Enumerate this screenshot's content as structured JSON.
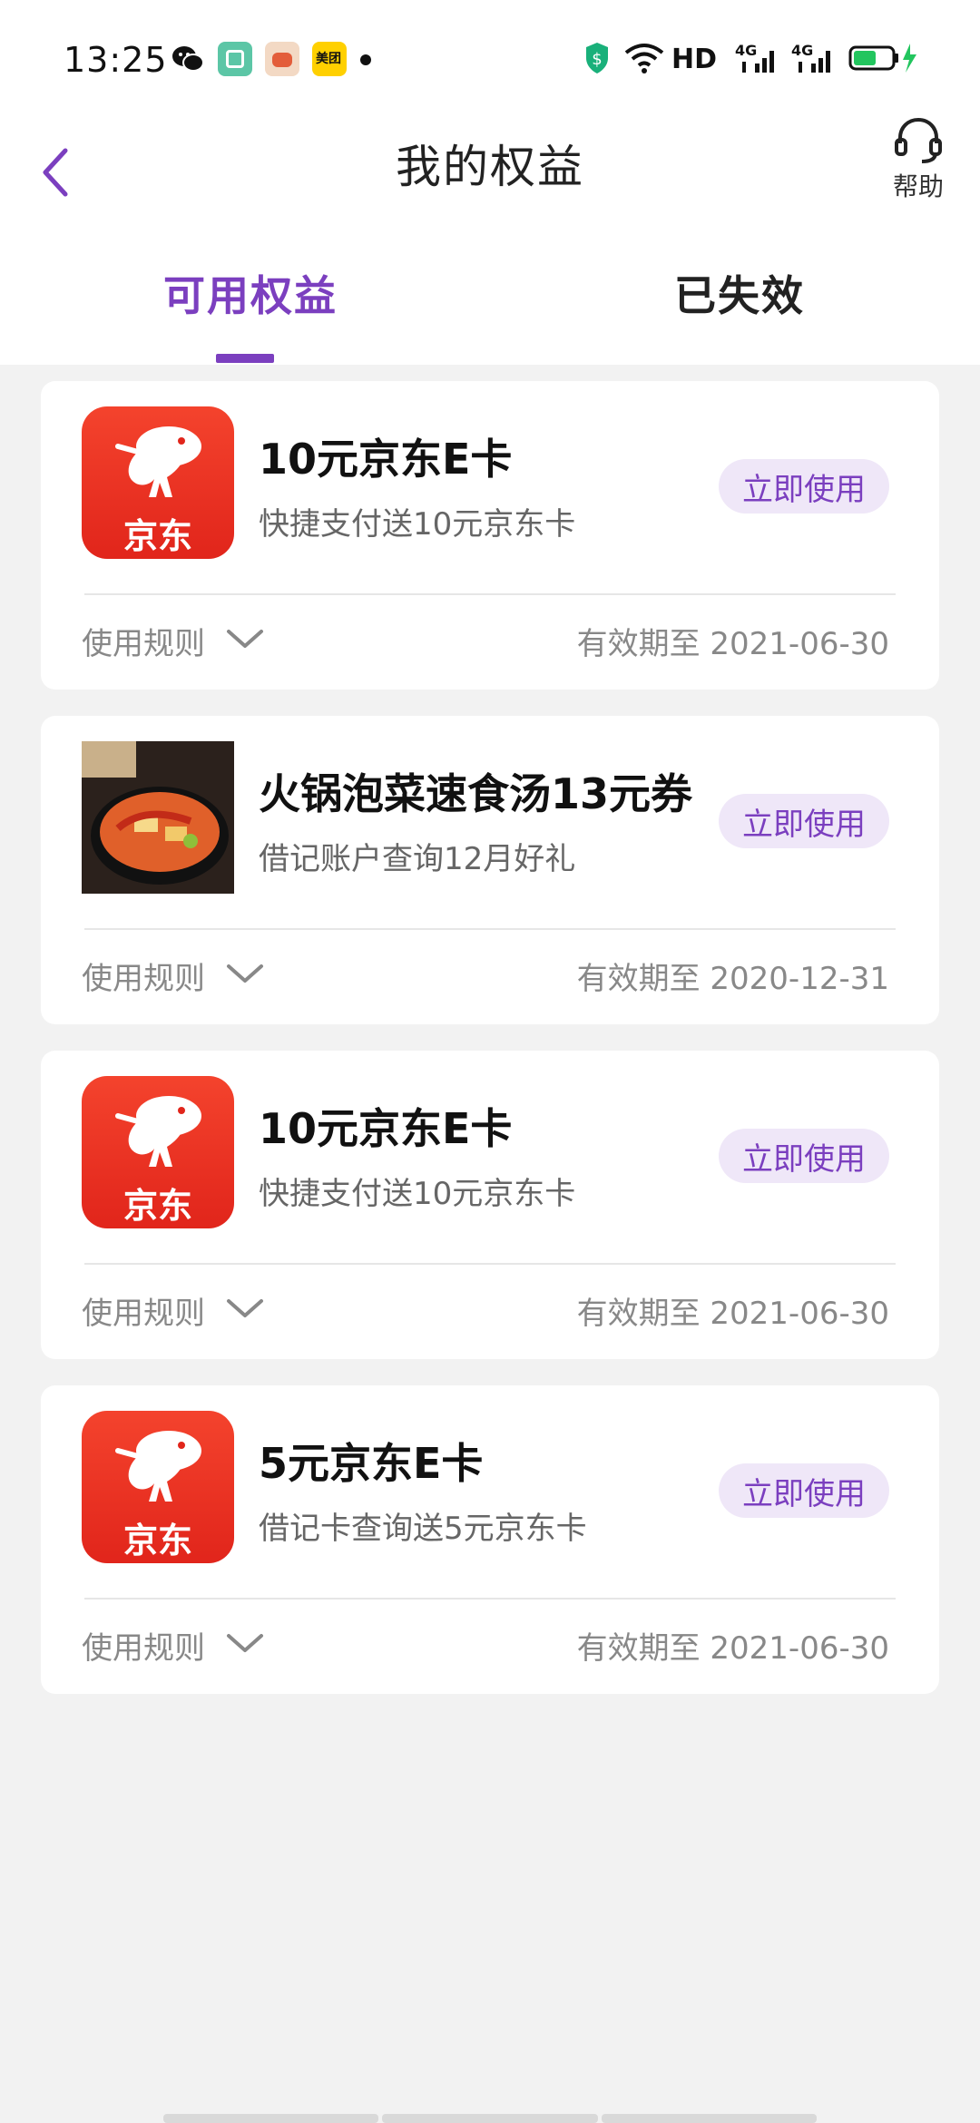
{
  "status_bar": {
    "time": "13:25",
    "network_label": "HD",
    "signal1": "4G",
    "signal2": "4G",
    "battery_color": "#22c55e"
  },
  "header": {
    "title": "我的权益",
    "help_label": "帮助"
  },
  "tabs": [
    {
      "label": "可用权益",
      "active": true
    },
    {
      "label": "已失效",
      "active": false
    }
  ],
  "colors": {
    "accent": "#7b3fbf",
    "jd_red": "#e1251b"
  },
  "cards": [
    {
      "thumb": "jd-logo-icon",
      "thumb_text": "京东",
      "title": "10元京东E卡",
      "desc": "快捷支付送10元京东卡",
      "button": "立即使用",
      "rule_label": "使用规则",
      "expiry": "有效期至 2021-06-30"
    },
    {
      "thumb": "hotpot-soup-image",
      "title": "火锅泡菜速食汤13元券",
      "desc": "借记账户查询12月好礼",
      "button": "立即使用",
      "rule_label": "使用规则",
      "expiry": "有效期至 2020-12-31"
    },
    {
      "thumb": "jd-logo-icon",
      "thumb_text": "京东",
      "title": "10元京东E卡",
      "desc": "快捷支付送10元京东卡",
      "button": "立即使用",
      "rule_label": "使用规则",
      "expiry": "有效期至 2021-06-30"
    },
    {
      "thumb": "jd-logo-icon",
      "thumb_text": "京东",
      "title": "5元京东E卡",
      "desc": "借记卡查询送5元京东卡",
      "button": "立即使用",
      "rule_label": "使用规则",
      "expiry": "有效期至 2021-06-30"
    }
  ]
}
